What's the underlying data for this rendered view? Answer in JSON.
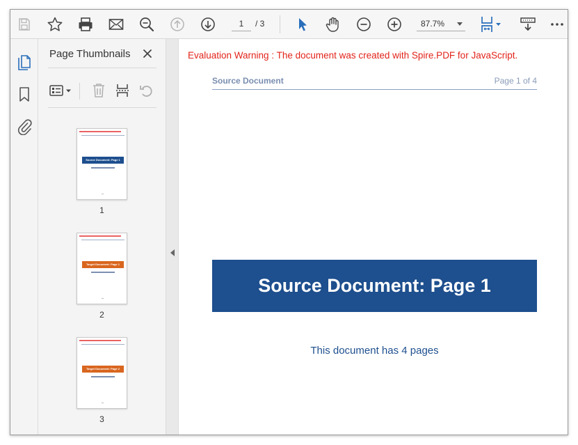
{
  "toolbar": {
    "page_current": "1",
    "page_total": "/ 3",
    "zoom": "87.7%"
  },
  "sidebar": {
    "panel_title": "Page Thumbnails",
    "thumbnails": [
      {
        "label": "1",
        "title": "Source Document: Page 1",
        "color": "#1e4f8e"
      },
      {
        "label": "2",
        "title": "Target Document: Page 1",
        "color": "#d9661f"
      },
      {
        "label": "3",
        "title": "Target Document: Page 2",
        "color": "#d9661f"
      }
    ]
  },
  "document": {
    "eval_warning": "Evaluation Warning : The document was created with Spire.PDF for JavaScript.",
    "header_left": "Source Document",
    "header_right": "Page 1 of 4",
    "banner_title": "Source Document: Page 1",
    "body_text": "This document has 4 pages"
  },
  "colors": {
    "accent_blue": "#1e4f8e",
    "accent_orange": "#d9661f",
    "warning_red": "#e2231a",
    "icon_blue": "#2a6ebb"
  }
}
